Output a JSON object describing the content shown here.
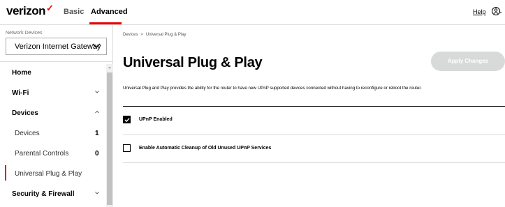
{
  "header": {
    "logo": "verizon",
    "tabs": [
      "Basic",
      "Advanced"
    ],
    "help": "Help"
  },
  "sidebar": {
    "network_devices_label": "Network Devices",
    "selected_device": "Verizon Internet Gateway",
    "items": [
      {
        "label": "Home"
      },
      {
        "label": "Wi-Fi"
      },
      {
        "label": "Devices"
      },
      {
        "label": "Devices",
        "count": "1"
      },
      {
        "label": "Parental Controls",
        "count": "0"
      },
      {
        "label": "Universal Plug & Play"
      },
      {
        "label": "Security & Firewall"
      }
    ]
  },
  "main": {
    "breadcrumb": [
      "Devices",
      "Universal Plug & Play"
    ],
    "breadcrumb_sep": ">",
    "title": "Universal Plug & Play",
    "apply_label": "Apply Changes",
    "description": "Universal Plug and Play provides the ability for the router to have new UPnP supported devices connected without having to reconfigure or reboot the router.",
    "options": [
      {
        "label": "UPnP Enabled",
        "checked": true
      },
      {
        "label": "Enable Automatic Cleanup of Old Unused UPnP Services",
        "checked": false
      }
    ]
  },
  "colors": {
    "brand_red": "#ee0000",
    "disabled_button": "#d8dada"
  },
  "icons": [
    "chevron-down-icon",
    "chevron-up-icon",
    "user-icon",
    "checkmark-icon"
  ]
}
